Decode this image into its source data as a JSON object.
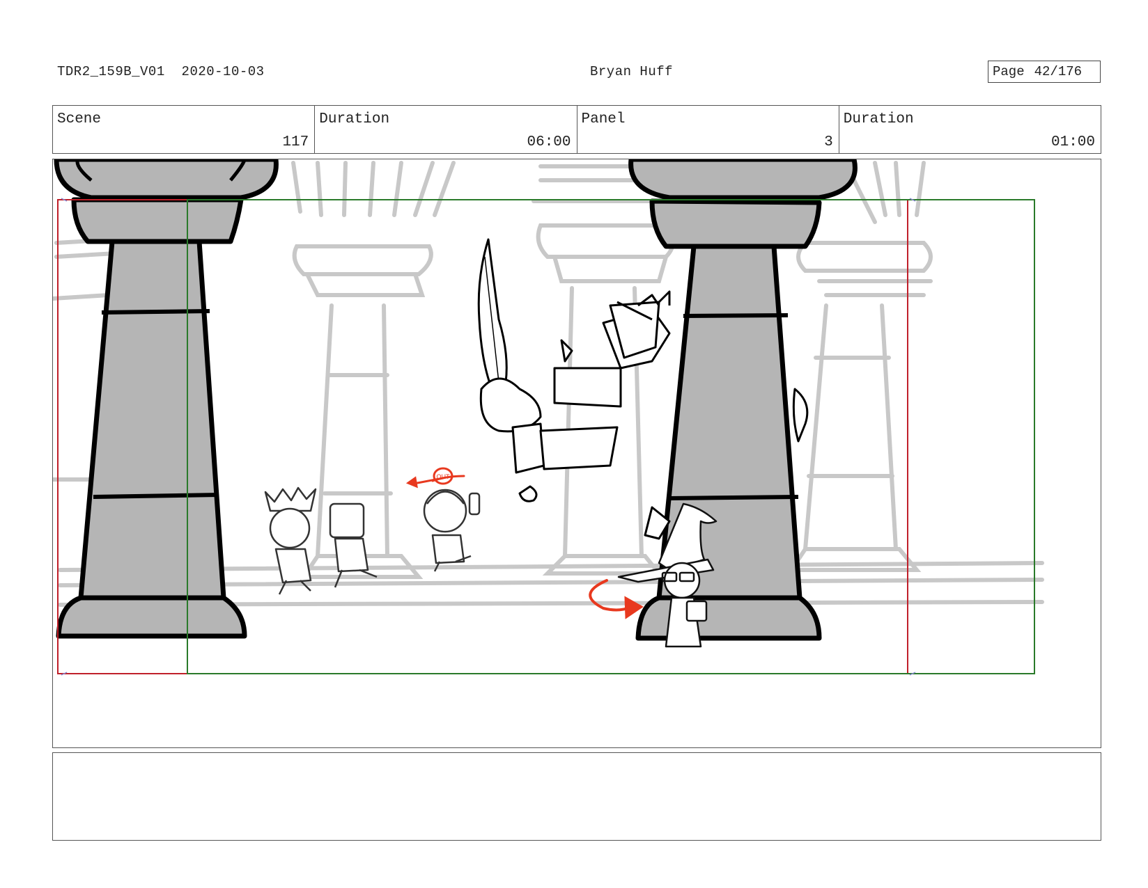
{
  "header": {
    "production_id": "TDR2_159B_V01",
    "date": "2020-10-03",
    "artist": "Bryan Huff",
    "page_label": "Page",
    "page_number": "42/176"
  },
  "info": {
    "scene_label": "Scene",
    "scene_value": "117",
    "scene_duration_label": "Duration",
    "scene_duration_value": "06:00",
    "panel_label": "Panel",
    "panel_value": "3",
    "panel_duration_label": "Duration",
    "panel_duration_value": "01:00"
  },
  "panel_art": {
    "annotation": "OUT",
    "colors": {
      "safe_frame": "#c0202a",
      "camera_frame": "#2a7a2a",
      "annotation": "#e8391f",
      "pillar_fill": "#b5b5b5",
      "background_lines": "#c8c8c8"
    }
  },
  "notes": {
    "text": ""
  }
}
